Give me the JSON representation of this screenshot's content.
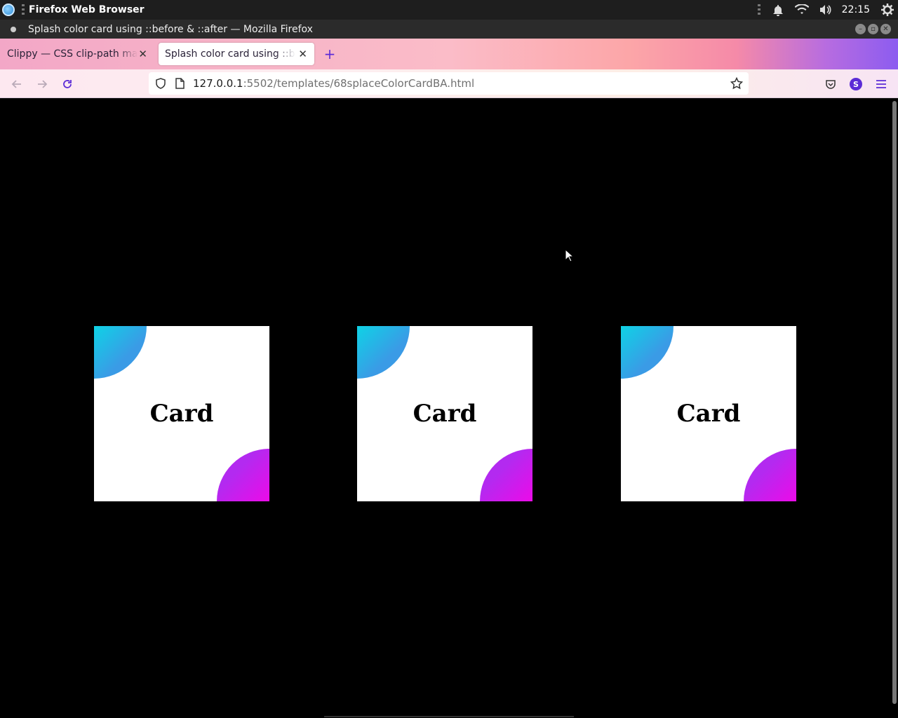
{
  "system_bar": {
    "app_name": "Firefox Web Browser",
    "clock": "22:15"
  },
  "window": {
    "title": "Splash color card using ::before & ::after — Mozilla Firefox"
  },
  "tabs": [
    {
      "label": "Clippy — CSS clip-path maker",
      "active": false
    },
    {
      "label": "Splash color card using ::before & ::after",
      "active": true
    }
  ],
  "url": {
    "host": "127.0.0.1",
    "rest": ":5502/templates/68splaceColorCardBA.html"
  },
  "profile": {
    "initial": "S"
  },
  "cards": [
    {
      "title": "Card"
    },
    {
      "title": "Card"
    },
    {
      "title": "Card"
    }
  ],
  "colors": {
    "splash_top_left": "#00e5e5",
    "splash_bottom_right": "#ff00e6",
    "page_background": "#000000",
    "card_background": "#ffffff"
  }
}
